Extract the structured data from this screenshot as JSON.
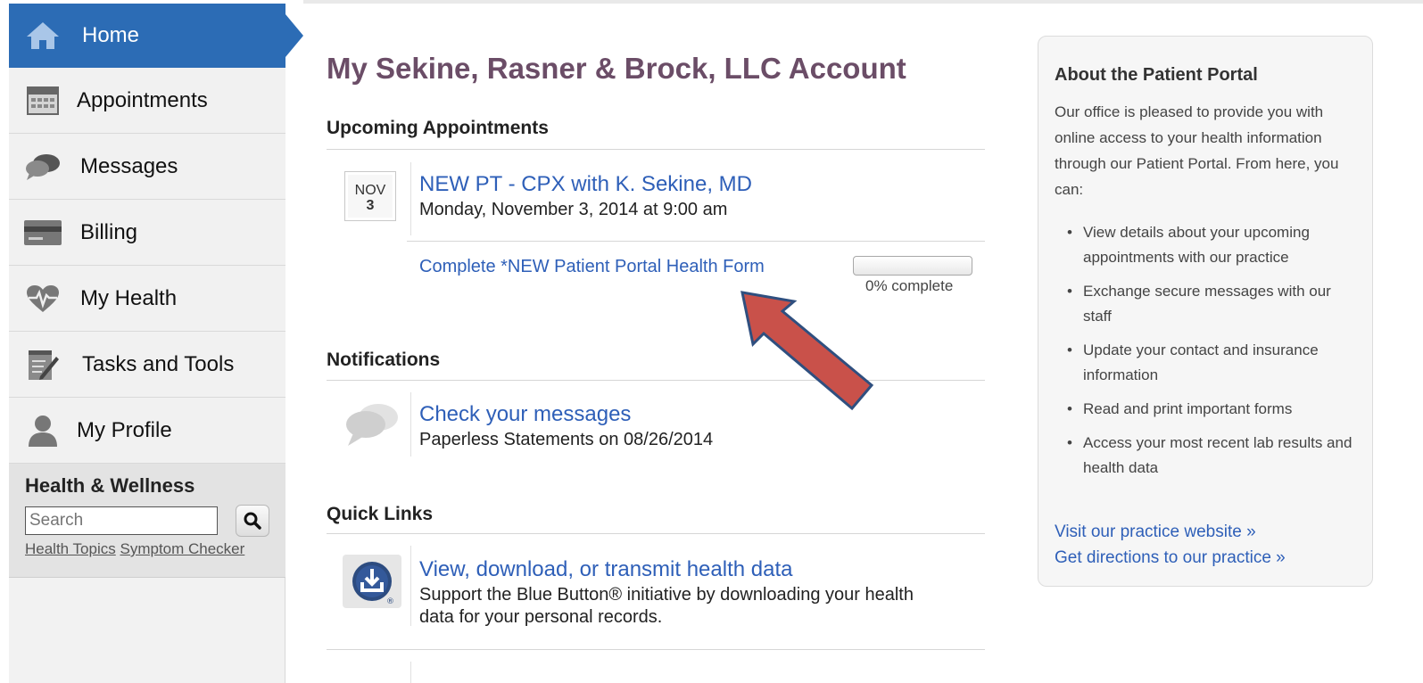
{
  "sidebar": {
    "items": [
      {
        "label": "Home",
        "icon": "home-icon"
      },
      {
        "label": "Appointments",
        "icon": "calendar-icon"
      },
      {
        "label": "Messages",
        "icon": "chat-bubble-icon"
      },
      {
        "label": "Billing",
        "icon": "credit-card-icon"
      },
      {
        "label": "My Health",
        "icon": "heart-pulse-icon"
      },
      {
        "label": "Tasks and Tools",
        "icon": "notepad-pencil-icon"
      },
      {
        "label": "My Profile",
        "icon": "person-icon"
      }
    ],
    "active_color": "#2c6cb5",
    "health_wellness": {
      "title": "Health & Wellness",
      "search_placeholder": "Search",
      "links": [
        "Health Topics",
        "Symptom Checker"
      ]
    }
  },
  "main": {
    "title": "My Sekine, Rasner & Brock, LLC Account",
    "upcoming": {
      "heading": "Upcoming Appointments",
      "appointment": {
        "month": "NOV",
        "day": "3",
        "title": "NEW PT - CPX with K. Sekine, MD",
        "datetime": "Monday, November 3, 2014 at 9:00 am",
        "task_link": "Complete *NEW Patient Portal Health Form",
        "progress_percent": 0,
        "progress_label": "0% complete"
      }
    },
    "notifications": {
      "heading": "Notifications",
      "item_title": "Check your messages",
      "item_detail": "Paperless Statements on 08/26/2014"
    },
    "quick_links": {
      "heading": "Quick Links",
      "item_title": "View, download, or transmit health data",
      "item_desc_line1": "Support the Blue Button® initiative by downloading your health",
      "item_desc_line2": "data for your personal records."
    }
  },
  "panel": {
    "title": "About the Patient Portal",
    "intro": "Our office is pleased to provide you with online access to your health information through our Patient Portal. From here, you can:",
    "bullets": [
      "View details about your upcoming appointments with our practice",
      "Exchange secure messages with our staff",
      "Update your contact and insurance information",
      "Read and print important forms",
      "Access your most recent lab results and health data"
    ],
    "link_website": "Visit our practice website »",
    "link_directions": "Get directions to our practice »"
  },
  "annotation_arrow_color": "#c9514a"
}
